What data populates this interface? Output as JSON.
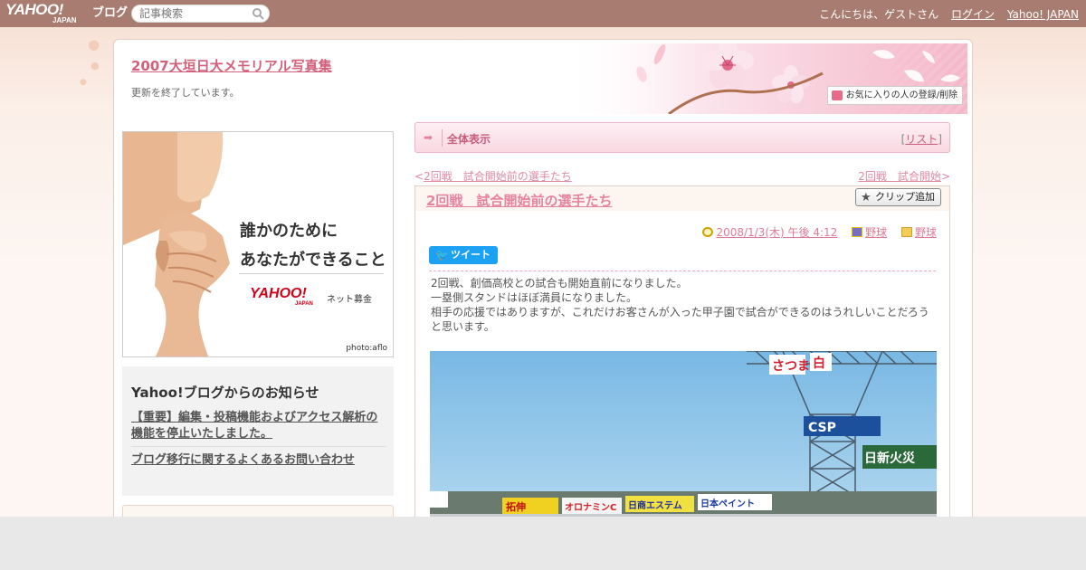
{
  "topbar": {
    "logo_text": "YAHOO!",
    "logo_sub": "JAPAN",
    "logo_blog": "ブログ",
    "search_placeholder": "記事検索",
    "greeting": "こんにちは、ゲストさん",
    "login": "ログイン",
    "yahoo_japan": "Yahoo! JAPAN"
  },
  "header": {
    "blog_title": "2007大垣日大メモリアル写真集",
    "description": "更新を終了しています。",
    "favorite_button": "お気に入りの人の登録/削除"
  },
  "ad": {
    "line1": "誰かのために",
    "line2": "あなたができること",
    "logo": "YAHOO!",
    "logo_sub": "JAPAN",
    "service": "ネット募金",
    "credit": "photo:aflo"
  },
  "notice": {
    "heading": "Yahoo!ブログからのお知らせ",
    "links": [
      "【重要】編集・投稿機能およびアクセス解析の機能を停止いたしました。",
      "ブログ移行に関するよくあるお問い合わせ"
    ]
  },
  "category_bar": {
    "label": "全体表示",
    "list_open": "[",
    "list_link": "リスト",
    "list_close": "]"
  },
  "nav": {
    "prev_mark": "<",
    "prev": "2回戦　試合開始前の選手たち",
    "next": "2回戦　試合開始",
    "next_mark": ">"
  },
  "entry": {
    "title": "2回戦　試合開始前の選手たち",
    "clip_button": "クリップ追加",
    "date": "2008/1/3(木) 午後 4:12",
    "category1": "野球",
    "category2": "野球",
    "tweet_button": "ツイート",
    "body": [
      "2回戦、創価高校との試合も開始直前になりました。",
      "一塁側スタンドはほぼ満員になりました。",
      "相手の応援ではありますが、これだけお客さんが入った甲子園で試合ができるのはうれしいことだろうと思います。"
    ]
  },
  "photo_signs": {
    "sign1": "さつま",
    "sign2": "白",
    "sign3": "CSP",
    "sign4": "日新火災",
    "sign5": "拓伸",
    "sign6": "オロナミンC",
    "sign7": "日商エステム",
    "sign8": "日本ペイント"
  },
  "colors": {
    "topbar": "#a87c70",
    "accent_pink": "#d2607a",
    "link_pink": "#e7839f",
    "tweet_blue": "#1da1f2"
  }
}
